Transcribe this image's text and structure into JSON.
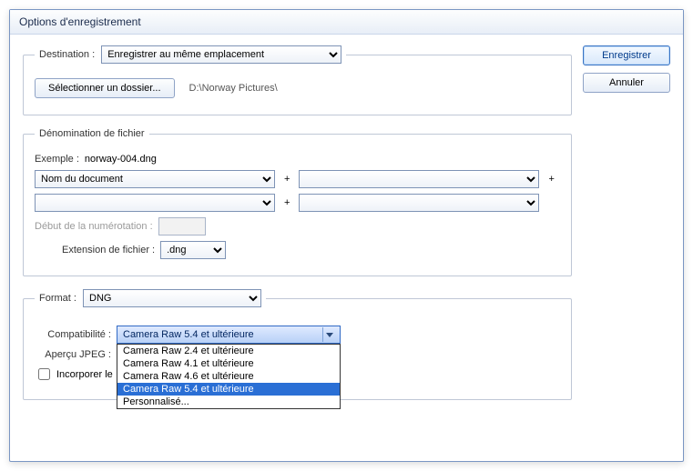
{
  "window": {
    "title": "Options d'enregistrement"
  },
  "buttons": {
    "save": "Enregistrer",
    "cancel": "Annuler"
  },
  "destination": {
    "legend": "Destination :",
    "location_selected": "Enregistrer au même emplacement",
    "select_folder_btn": "Sélectionner un dossier...",
    "path": "D:\\Norway Pictures\\"
  },
  "filenaming": {
    "legend": "Dénomination de fichier",
    "example_label": "Exemple :",
    "example_value": "norway-004.dng",
    "segment1": "Nom du document",
    "segment2": "",
    "segment3": "",
    "segment4": "",
    "plus": "+",
    "begin_numbering_label": "Début de la numérotation :",
    "begin_numbering_value": "",
    "extension_label": "Extension de fichier :",
    "extension_value": ".dng"
  },
  "format": {
    "legend": "Format :",
    "selected": "DNG",
    "compat_label": "Compatibilité :",
    "compat_selected": "Camera Raw 5.4 et ultérieure",
    "options": [
      "Camera Raw 2.4 et ultérieure",
      "Camera Raw 4.1 et ultérieure",
      "Camera Raw 4.6 et ultérieure",
      "Camera Raw 5.4 et ultérieure",
      "Personnalisé..."
    ],
    "jpeg_preview_label": "Aperçu JPEG :",
    "embed_label": "Incorporer le"
  }
}
